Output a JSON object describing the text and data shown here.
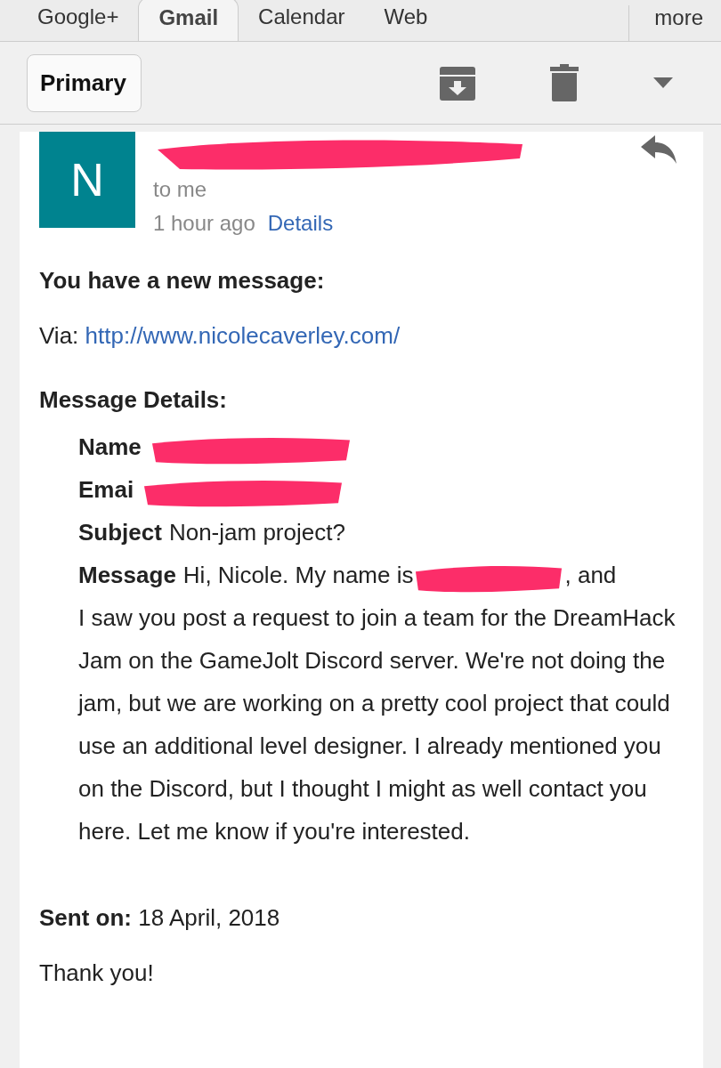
{
  "tabs": [
    {
      "label": "Google+",
      "selected": false
    },
    {
      "label": "Gmail",
      "selected": true
    },
    {
      "label": "Calendar",
      "selected": false
    },
    {
      "label": "Web",
      "selected": false
    }
  ],
  "more": "more",
  "back_button": "Primary",
  "email": {
    "avatar_letter": "N",
    "recipient": "to me",
    "time": "1 hour ago",
    "details_link": "Details",
    "heading": "You have a new message:",
    "via_label": "Via:",
    "via_link": "http://www.nicolecaverley.com/",
    "details_heading": "Message Details:",
    "fields": [
      {
        "label": "Name",
        "redacted": true
      },
      {
        "label": "Emai",
        "redacted": true
      },
      {
        "label": "Subject",
        "value": "Non-jam project?",
        "redacted": false
      },
      {
        "label": "Message",
        "value": "Hi, Nicole. My name is",
        "redacted": true,
        "after": ", and",
        "continuation": "I saw you post a request to join a team for the DreamHack Jam on the GameJolt Discord server. We're not doing the jam, but we are working on a pretty cool project that could use an additional level designer. I already mentioned you on the Discord, but I thought I might as well contact you here. Let me know if you're interested."
      }
    ],
    "sent_label": "Sent on:",
    "sent_date": "18 April, 2018",
    "closing": "Thank you!"
  }
}
